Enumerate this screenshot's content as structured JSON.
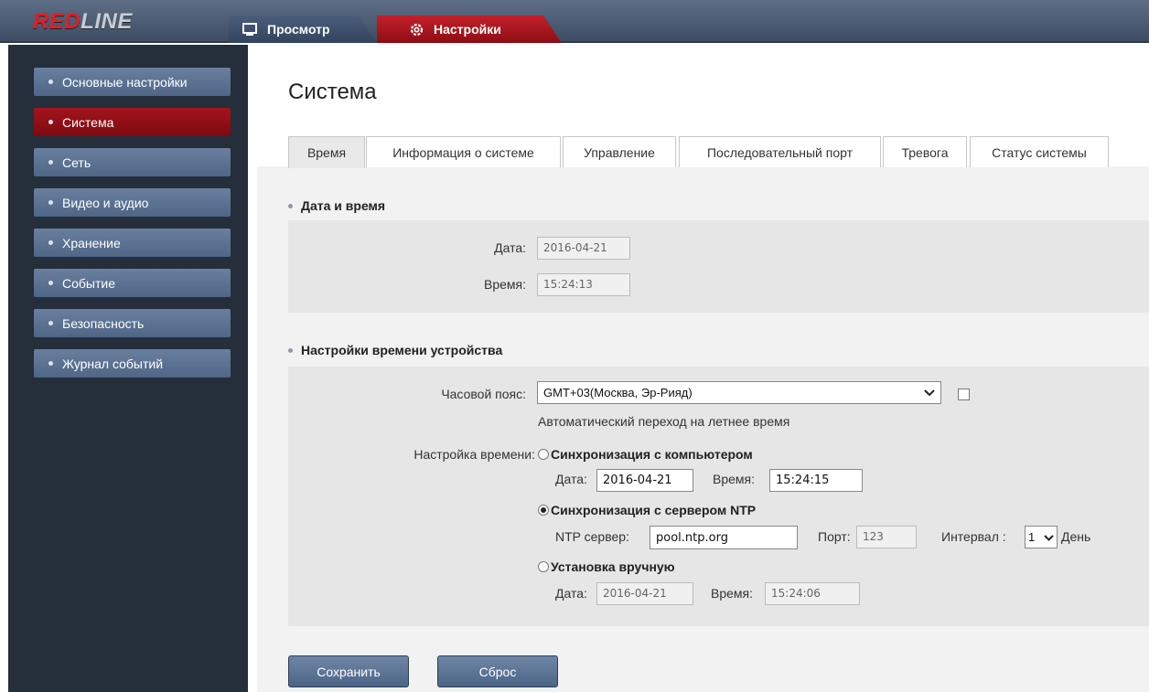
{
  "header": {
    "logo_red": "RED",
    "logo_rest": "LINE",
    "tabs": [
      {
        "label": "Просмотр"
      },
      {
        "label": "Настройки"
      }
    ]
  },
  "sidebar": {
    "items": [
      {
        "label": "Основные настройки"
      },
      {
        "label": "Система"
      },
      {
        "label": "Сеть"
      },
      {
        "label": "Видео и аудио"
      },
      {
        "label": "Хранение"
      },
      {
        "label": "Событие"
      },
      {
        "label": "Безопасность"
      },
      {
        "label": "Журнал событий"
      }
    ],
    "active_index": 1
  },
  "main": {
    "title": "Система",
    "tabs": [
      {
        "label": "Время"
      },
      {
        "label": "Информация о системе"
      },
      {
        "label": "Управление"
      },
      {
        "label": "Последовательный порт"
      },
      {
        "label": "Тревога"
      },
      {
        "label": "Статус системы"
      }
    ],
    "active_tab": 0,
    "date_time": {
      "heading": "Дата и время",
      "date_label": "Дата:",
      "date_value": "2016-04-21",
      "time_label": "Время:",
      "time_value": "15:24:13"
    },
    "device_time": {
      "heading": "Настройки времени устройства",
      "timezone_label": "Часовой пояс:",
      "timezone_value": "GMT+03(Москва, Эр-Рияд)",
      "dst_label": "Автоматический переход на летнее время",
      "dst_checked": false,
      "time_setting_label": "Настройка времени:",
      "sync_pc": {
        "label": "Синхронизация с компьютером",
        "selected": false,
        "date_label": "Дата:",
        "date_value": "2016-04-21",
        "time_label": "Время:",
        "time_value": "15:24:15"
      },
      "sync_ntp": {
        "label": "Синхронизация с сервером NTP",
        "selected": true,
        "server_label": "NTP сервер:",
        "server_value": "pool.ntp.org",
        "port_label": "Порт:",
        "port_value": "123",
        "interval_label": "Интервал :",
        "interval_value": "1",
        "interval_unit": "День"
      },
      "manual": {
        "label": "Установка вручную",
        "selected": false,
        "date_label": "Дата:",
        "date_value": "2016-04-21",
        "time_label": "Время:",
        "time_value": "15:24:06"
      }
    },
    "buttons": {
      "save": "Сохранить",
      "reset": "Сброс"
    }
  },
  "colors": {
    "accent_red": "#a3141c",
    "nav_blue": "#5a7193",
    "sidebar_bg": "#252e3b"
  }
}
